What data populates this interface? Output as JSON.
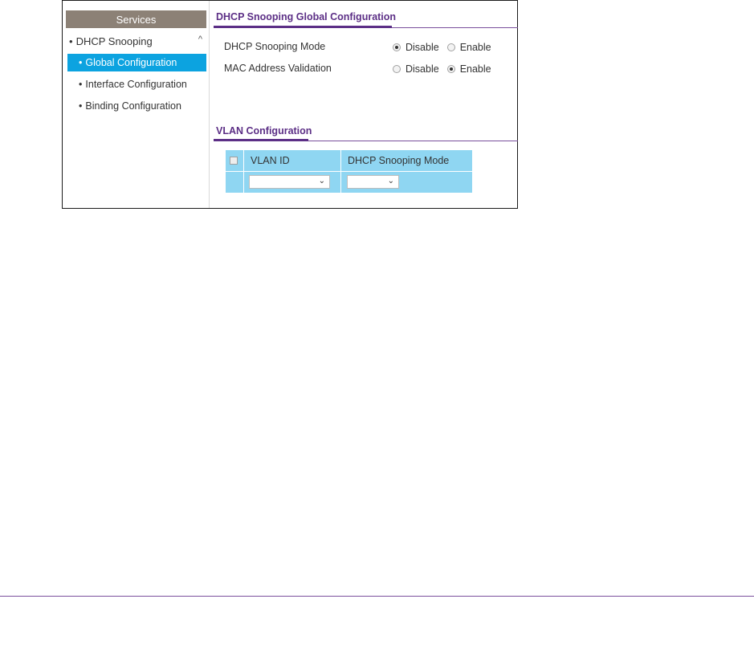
{
  "sidebar": {
    "header": "Services",
    "group": {
      "label": "DHCP Snooping",
      "chevron": "^"
    },
    "items": [
      {
        "label": "Global Configuration",
        "active": true
      },
      {
        "label": "Interface Configuration",
        "active": false
      },
      {
        "label": "Binding Configuration",
        "active": false
      }
    ]
  },
  "global_config": {
    "title": "DHCP Snooping Global Configuration",
    "rows": [
      {
        "label": "DHCP Snooping Mode",
        "options": [
          "Disable",
          "Enable"
        ],
        "selected": "Disable"
      },
      {
        "label": "MAC Address Validation",
        "options": [
          "Disable",
          "Enable"
        ],
        "selected": "Enable"
      }
    ]
  },
  "vlan_config": {
    "title": "VLAN Configuration",
    "columns": [
      "VLAN ID",
      "DHCP Snooping Mode"
    ],
    "vlan_id_value": "",
    "mode_value": ""
  },
  "colors": {
    "accent_purple": "#5c2f86",
    "active_blue": "#0ca3e0",
    "table_blue": "#8fd6f2",
    "sidebar_header": "#8c8176"
  }
}
